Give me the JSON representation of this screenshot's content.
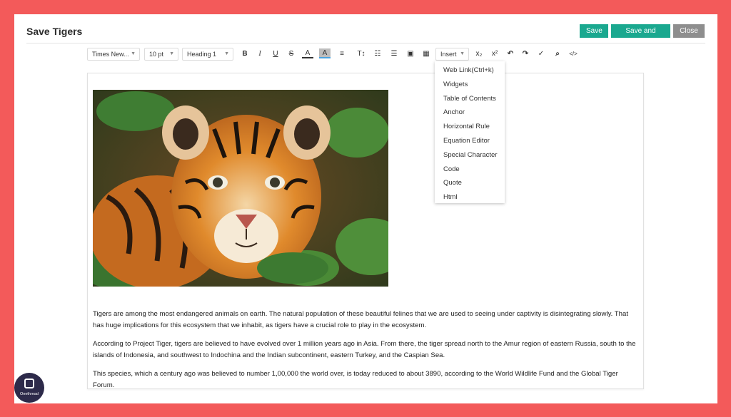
{
  "window": {
    "title": "Save Tigers"
  },
  "header": {
    "save": "Save",
    "save_and_close": "Save and Close",
    "close": "Close"
  },
  "toolbar": {
    "font_family": "Times New...",
    "font_size": "10 pt",
    "block_format": "Heading 1",
    "bold": "B",
    "italic": "I",
    "underline": "U",
    "strike": "S",
    "font_color": "A",
    "highlight": "A",
    "align": "≡",
    "text_size": "T↕",
    "ordered_list": "☷",
    "bullet_list": "☰",
    "image": "▣",
    "table": "▦",
    "insert": "Insert",
    "subscript": "x₂",
    "superscript": "x²",
    "undo": "↶",
    "redo": "↷",
    "spellcheck": "✓",
    "find": "⌕",
    "source": "</>"
  },
  "insert_menu": {
    "items": [
      "Web Link(Ctrl+k)",
      "Widgets",
      "Table of Contents",
      "Anchor",
      "Horizontal Rule",
      "Equation Editor",
      "Special Character",
      "Code",
      "Quote",
      "Html"
    ]
  },
  "content": {
    "image_subject": "tiger cub",
    "paragraphs": [
      "Tigers are among the most endangered animals on earth. The natural population of these beautiful felines that we are used to seeing under captivity is disintegrating slowly. That has huge implications for this ecosystem that we inhabit, as tigers have a crucial role to play in the ecosystem.",
      " According to Project Tiger, tigers are believed to have evolved over 1 million years ago in Asia. From there, the tiger spread north to the Amur region of eastern Russia, south to the islands of Indonesia, and southwest to Indochina and the Indian subcontinent, eastern Turkey, and the Caspian Sea.",
      " This species, which a century ago was believed to number 1,00,000 the world over, is today reduced to about 3890, according to the World Wildlife Fund and the Global Tiger Forum."
    ]
  },
  "logo": {
    "text": "Onethread"
  },
  "colors": {
    "frame": "#f35a5a",
    "primary": "#1aa88f",
    "close": "#8e8e8e"
  }
}
